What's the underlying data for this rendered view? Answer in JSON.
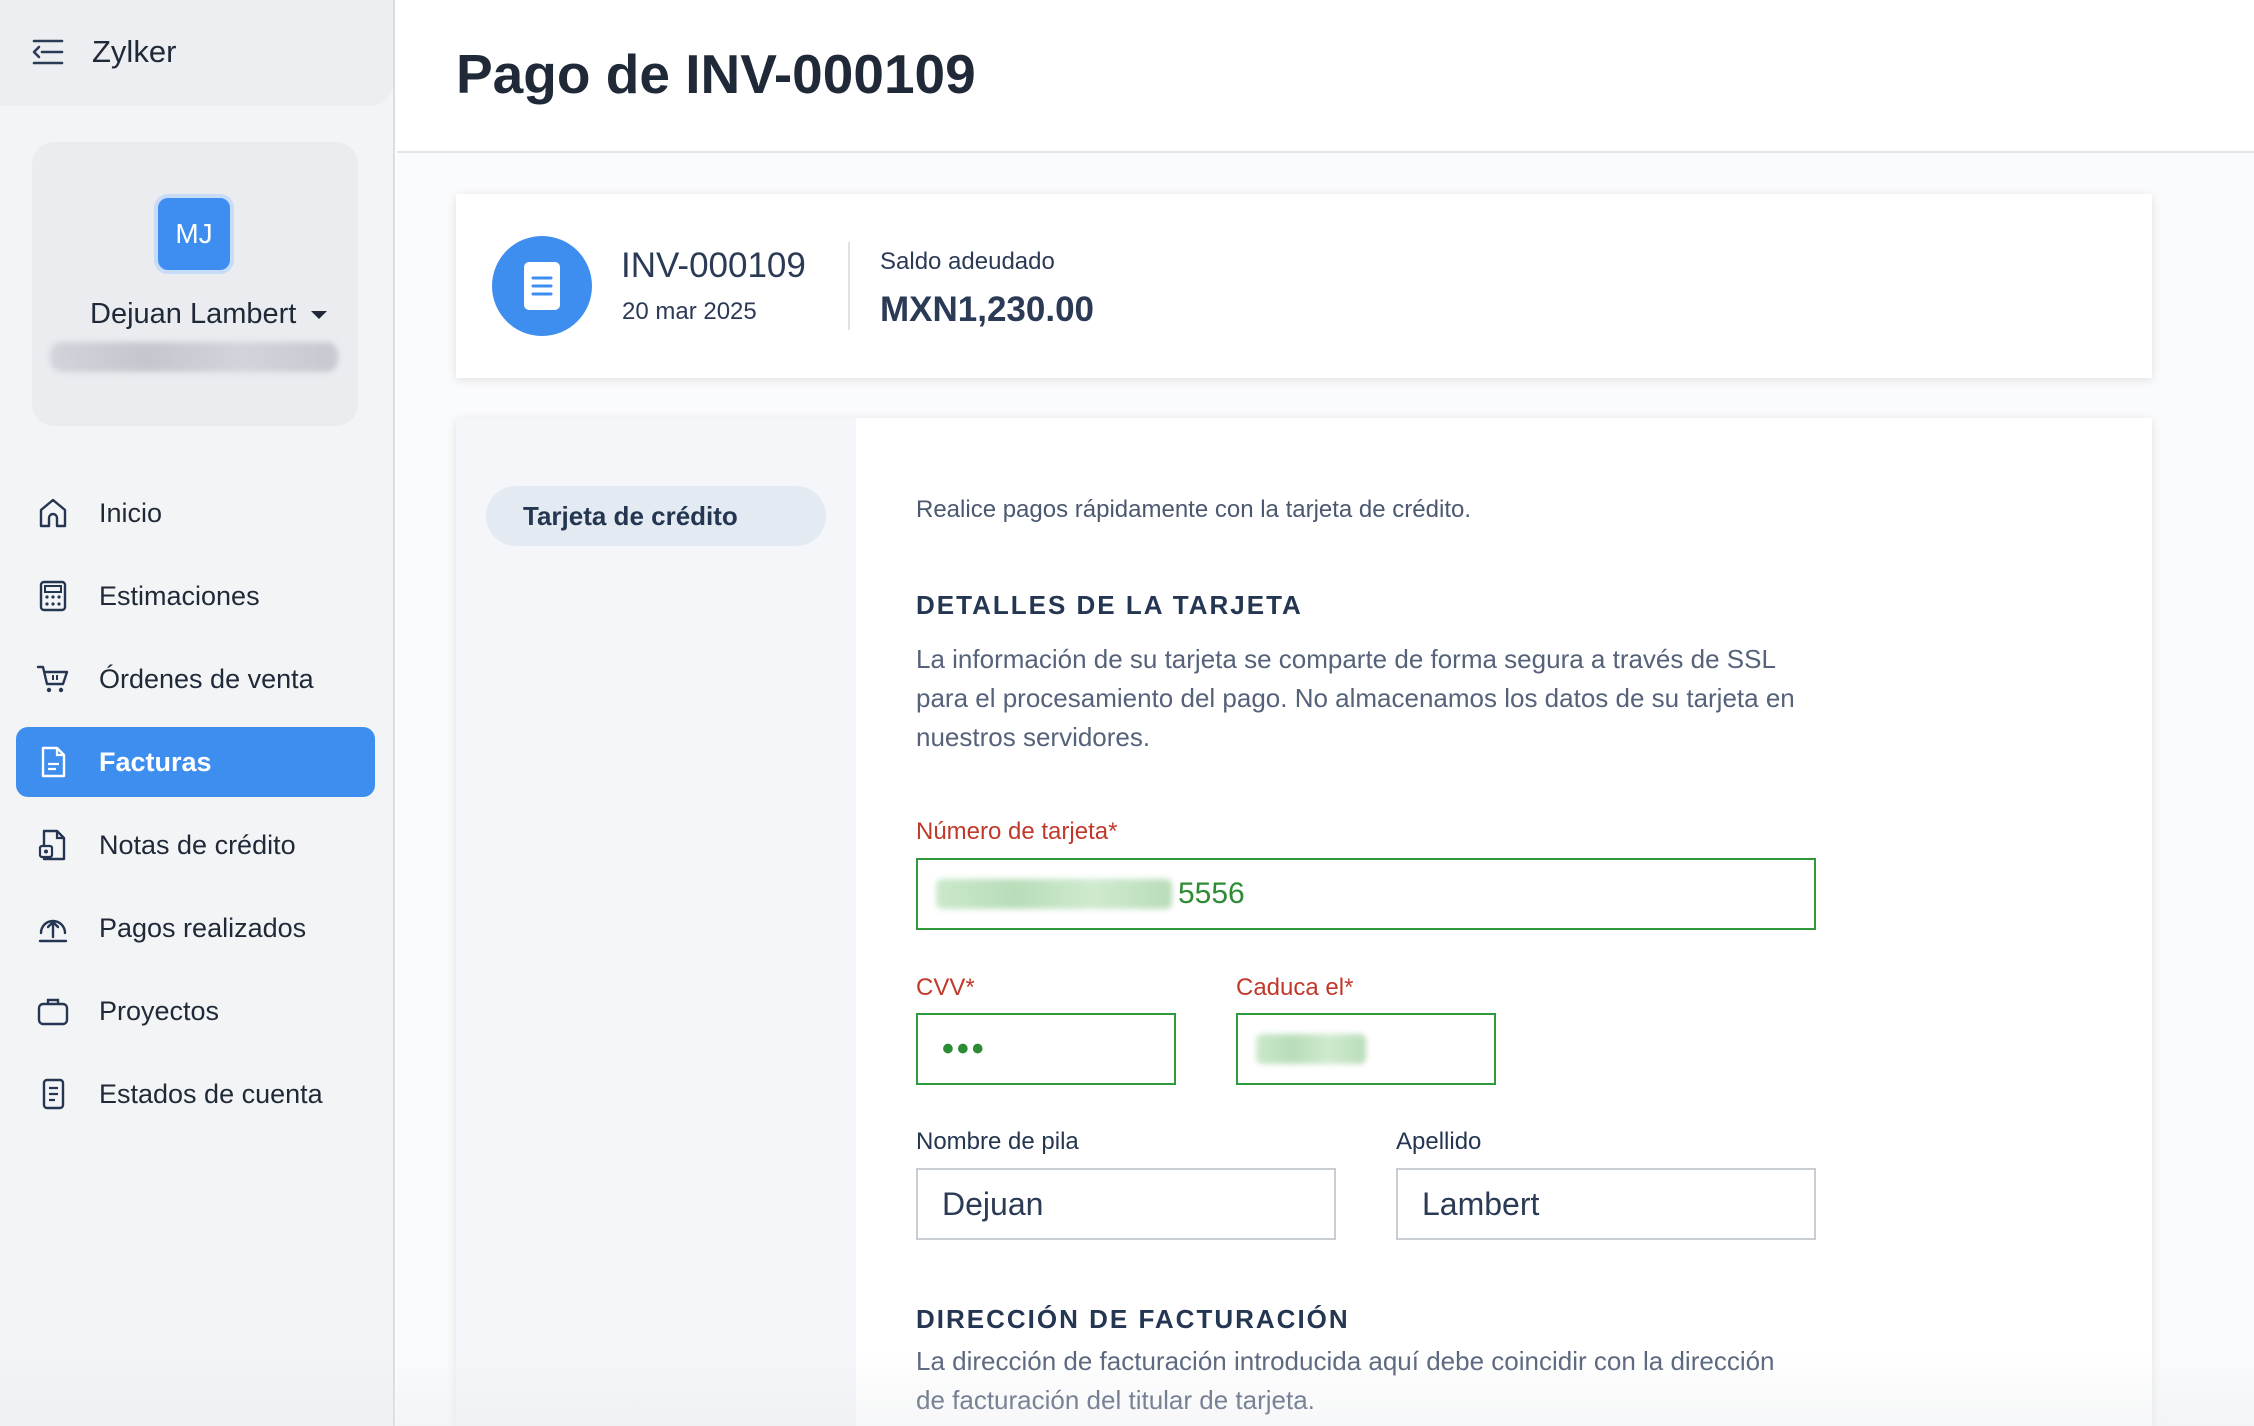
{
  "app": {
    "brand": "Zylker"
  },
  "user": {
    "initials": "MJ",
    "name": "Dejuan Lambert"
  },
  "sidebar": {
    "items": [
      {
        "label": "Inicio",
        "icon": "home-icon",
        "active": false
      },
      {
        "label": "Estimaciones",
        "icon": "calculator-icon",
        "active": false
      },
      {
        "label": "Órdenes de venta",
        "icon": "cart-icon",
        "active": false
      },
      {
        "label": "Facturas",
        "icon": "invoice-icon",
        "active": true
      },
      {
        "label": "Notas de crédito",
        "icon": "credit-note-icon",
        "active": false
      },
      {
        "label": "Pagos realizados",
        "icon": "upload-payment-icon",
        "active": false
      },
      {
        "label": "Proyectos",
        "icon": "briefcase-icon",
        "active": false
      },
      {
        "label": "Estados de cuenta",
        "icon": "statement-icon",
        "active": false
      }
    ]
  },
  "page": {
    "title": "Pago de INV-000109"
  },
  "invoice": {
    "number": "INV-000109",
    "date": "20 mar 2025",
    "balance_label": "Saldo adeudado",
    "balance_value": "MXN1,230.00",
    "icon": "document-icon"
  },
  "payment": {
    "method_label": "Tarjeta de crédito",
    "intro": "Realice pagos rápidamente con la tarjeta de crédito.",
    "card_section_title": "DETALLES DE LA TARJETA",
    "card_section_desc": "La información de su tarjeta se comparte de forma segura a través de SSL para el procesamiento del pago. No almacenamos los datos de su tarjeta en nuestros servidores.",
    "card_number_label": "Número de tarjeta*",
    "card_number_last4": "5556",
    "cvv_label": "CVV*",
    "cvv_value": "•••",
    "expiry_label": "Caduca el*",
    "first_name_label": "Nombre de pila",
    "first_name_value": "Dejuan",
    "last_name_label": "Apellido",
    "last_name_value": "Lambert",
    "billing_section_title": "DIRECCIÓN DE FACTURACIÓN",
    "billing_section_desc": "La dirección de facturación introducida aquí debe coincidir con la dirección de facturación del titular de tarjeta."
  },
  "colors": {
    "accent": "#3e8ef0",
    "valid": "#2e9a3c",
    "required": "#c0392b",
    "heading": "#243652"
  }
}
